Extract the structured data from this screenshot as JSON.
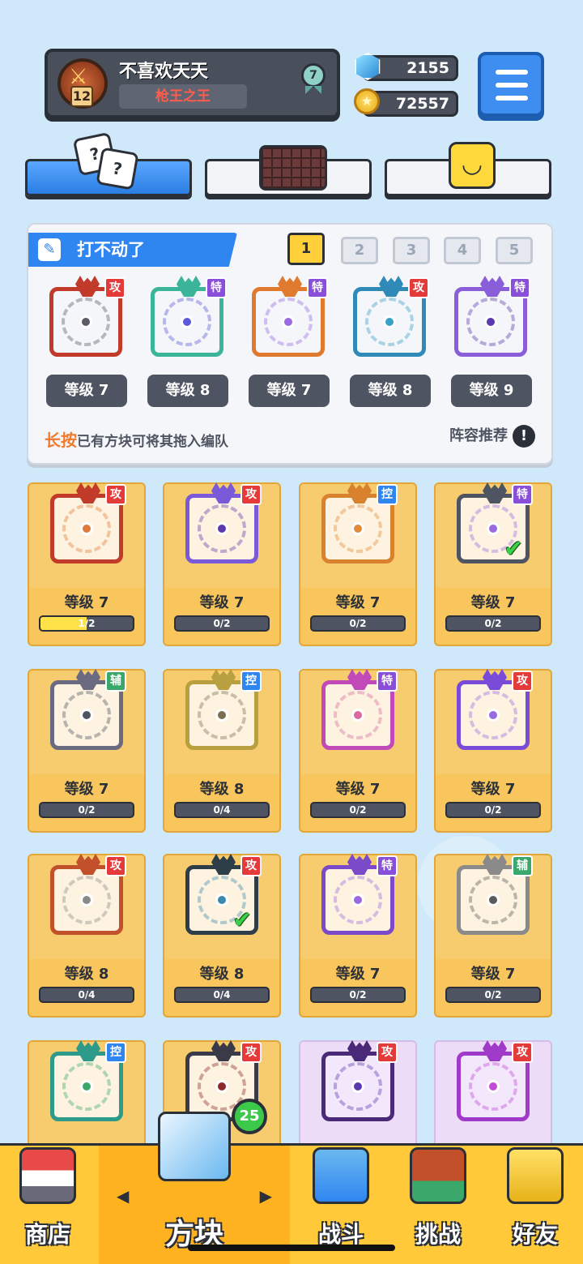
{
  "player": {
    "name": "不喜欢天天",
    "title": "枪王之王",
    "level": "12",
    "rank": "7"
  },
  "currency": {
    "gems": "2155",
    "coins": "72557"
  },
  "deck": {
    "name": "打不动了",
    "slots": [
      "1",
      "2",
      "3",
      "4",
      "5"
    ],
    "active_slot": "1",
    "cards": [
      {
        "tag": "攻",
        "level": "等级 7",
        "color": "#c23a2a",
        "accent": "#5b5b66"
      },
      {
        "tag": "特",
        "level": "等级 8",
        "color": "#3ab59a",
        "accent": "#5b5ad8"
      },
      {
        "tag": "特",
        "level": "等级 7",
        "color": "#e07a2e",
        "accent": "#9a6ae0"
      },
      {
        "tag": "攻",
        "level": "等级 8",
        "color": "#2f8ab8",
        "accent": "#3aa0c8"
      },
      {
        "tag": "特",
        "level": "等级 9",
        "color": "#8a5ed8",
        "accent": "#5b3ab0"
      }
    ],
    "hint_strong": "长按",
    "hint_rest": "已有方块可将其拖入编队",
    "recommend": "阵容推荐",
    "recommend_icon": "!"
  },
  "collection": [
    {
      "tag": "攻",
      "level": "等级 7",
      "progress": "1/2",
      "fill": 0.5,
      "color": "#c23a2a",
      "accent": "#e07a3a",
      "check": false
    },
    {
      "tag": "攻",
      "level": "等级 7",
      "progress": "0/2",
      "fill": 0,
      "color": "#7a5ad8",
      "accent": "#5b3ab0",
      "check": false
    },
    {
      "tag": "控",
      "level": "等级 7",
      "progress": "0/2",
      "fill": 0,
      "color": "#d8822e",
      "accent": "#e08a3a",
      "check": false
    },
    {
      "tag": "特",
      "level": "等级 7",
      "progress": "0/2",
      "fill": 0,
      "color": "#4e5461",
      "accent": "#9a6ae0",
      "check": true
    },
    {
      "tag": "辅",
      "level": "等级 7",
      "progress": "0/2",
      "fill": 0,
      "color": "#6a6a80",
      "accent": "#4e5461",
      "check": false
    },
    {
      "tag": "控",
      "level": "等级 8",
      "progress": "0/4",
      "fill": 0,
      "color": "#b8a040",
      "accent": "#7a7050",
      "check": false
    },
    {
      "tag": "特",
      "level": "等级 7",
      "progress": "0/2",
      "fill": 0,
      "color": "#c24ab8",
      "accent": "#d86aa0",
      "check": false
    },
    {
      "tag": "攻",
      "level": "等级 7",
      "progress": "0/2",
      "fill": 0,
      "color": "#7a4ad8",
      "accent": "#9a6ae0",
      "check": false
    },
    {
      "tag": "攻",
      "level": "等级 8",
      "progress": "0/4",
      "fill": 0,
      "color": "#c2502a",
      "accent": "#8a8a8a",
      "check": false
    },
    {
      "tag": "攻",
      "level": "等级 8",
      "progress": "0/4",
      "fill": 0,
      "color": "#2e3e48",
      "accent": "#3a8ab0",
      "check": true
    },
    {
      "tag": "特",
      "level": "等级 7",
      "progress": "0/2",
      "fill": 0,
      "color": "#7a4ac8",
      "accent": "#9a6ae0",
      "check": false
    },
    {
      "tag": "辅",
      "level": "等级 7",
      "progress": "0/2",
      "fill": 0,
      "color": "#8a8a8a",
      "accent": "#5b5b5b",
      "check": false
    },
    {
      "tag": "控",
      "level": "",
      "progress": "",
      "fill": 0,
      "color": "#2e9a8a",
      "accent": "#3aa86b",
      "check": false
    },
    {
      "tag": "攻",
      "level": "",
      "progress": "",
      "fill": 0,
      "color": "#3a3a48",
      "accent": "#8a2a2a",
      "check": false
    },
    {
      "tag": "攻",
      "level": "",
      "progress": "",
      "fill": 0,
      "color": "#4a2a78",
      "accent": "#5b3ab0",
      "check": false,
      "purple": true
    },
    {
      "tag": "攻",
      "level": "",
      "progress": "",
      "fill": 0,
      "color": "#a03ac8",
      "accent": "#c24ad8",
      "check": false,
      "purple": true
    }
  ],
  "nav": {
    "shop": "商店",
    "blocks": "方块",
    "battle": "战斗",
    "challenge": "挑战",
    "friends": "好友",
    "new_count": "25"
  }
}
